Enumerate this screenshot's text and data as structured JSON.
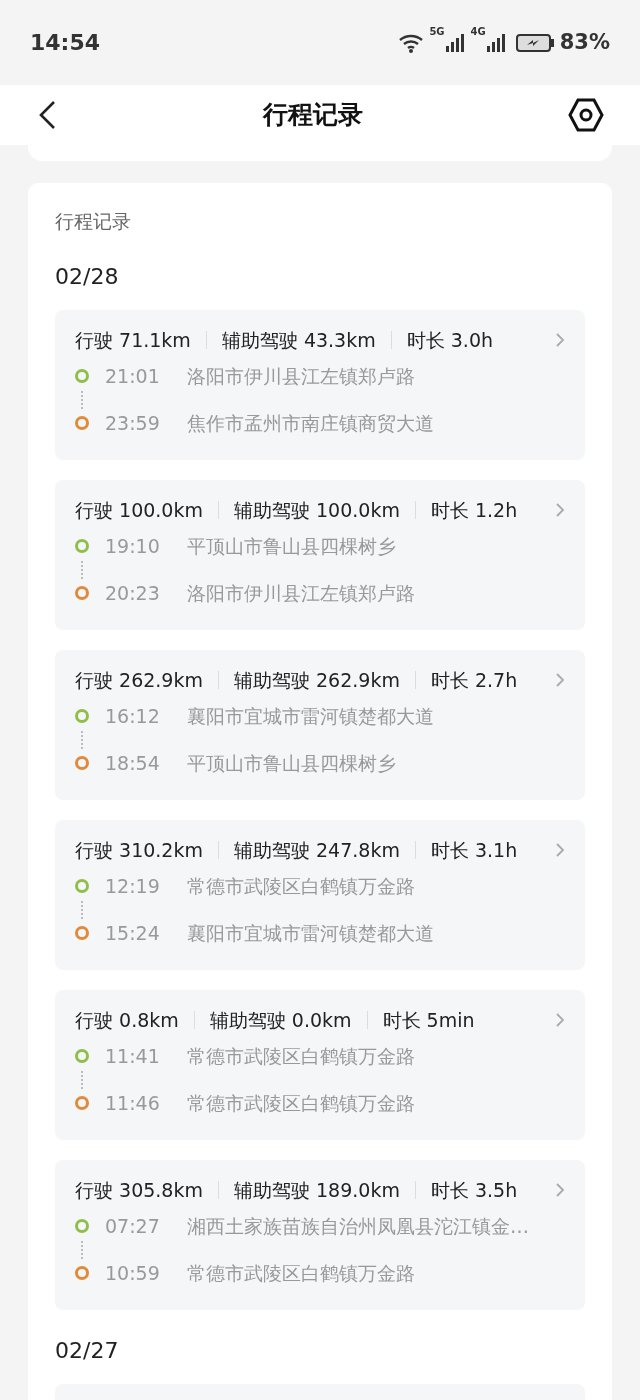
{
  "status_bar": {
    "time": "14:54",
    "network_1": "5G",
    "network_2": "4G",
    "battery": "83%"
  },
  "header": {
    "title": "行程记录"
  },
  "section": {
    "title": "行程记录",
    "groups": [
      {
        "date": "02/28",
        "trips": [
          {
            "distance": "行驶 71.1km",
            "assisted": "辅助驾驶 43.3km",
            "duration": "时长 3.0h",
            "start_time": "21:01",
            "start_place": "洛阳市伊川县江左镇郑卢路",
            "end_time": "23:59",
            "end_place": "焦作市孟州市南庄镇商贸大道"
          },
          {
            "distance": "行驶 100.0km",
            "assisted": "辅助驾驶 100.0km",
            "duration": "时长 1.2h",
            "start_time": "19:10",
            "start_place": "平顶山市鲁山县四棵树乡",
            "end_time": "20:23",
            "end_place": "洛阳市伊川县江左镇郑卢路"
          },
          {
            "distance": "行驶 262.9km",
            "assisted": "辅助驾驶 262.9km",
            "duration": "时长 2.7h",
            "start_time": "16:12",
            "start_place": "襄阳市宜城市雷河镇楚都大道",
            "end_time": "18:54",
            "end_place": "平顶山市鲁山县四棵树乡"
          },
          {
            "distance": "行驶 310.2km",
            "assisted": "辅助驾驶 247.8km",
            "duration": "时长 3.1h",
            "start_time": "12:19",
            "start_place": "常德市武陵区白鹤镇万金路",
            "end_time": "15:24",
            "end_place": "襄阳市宜城市雷河镇楚都大道"
          },
          {
            "distance": "行驶 0.8km",
            "assisted": "辅助驾驶 0.0km",
            "duration": "时长 5min",
            "start_time": "11:41",
            "start_place": "常德市武陵区白鹤镇万金路",
            "end_time": "11:46",
            "end_place": "常德市武陵区白鹤镇万金路"
          },
          {
            "distance": "行驶 305.8km",
            "assisted": "辅助驾驶 189.0km",
            "duration": "时长 3.5h",
            "start_time": "07:27",
            "start_place": "湘西土家族苗族自治州凤凰县沱江镇金…",
            "end_time": "10:59",
            "end_place": "常德市武陵区白鹤镇万金路"
          }
        ]
      },
      {
        "date": "02/27"
      }
    ]
  }
}
